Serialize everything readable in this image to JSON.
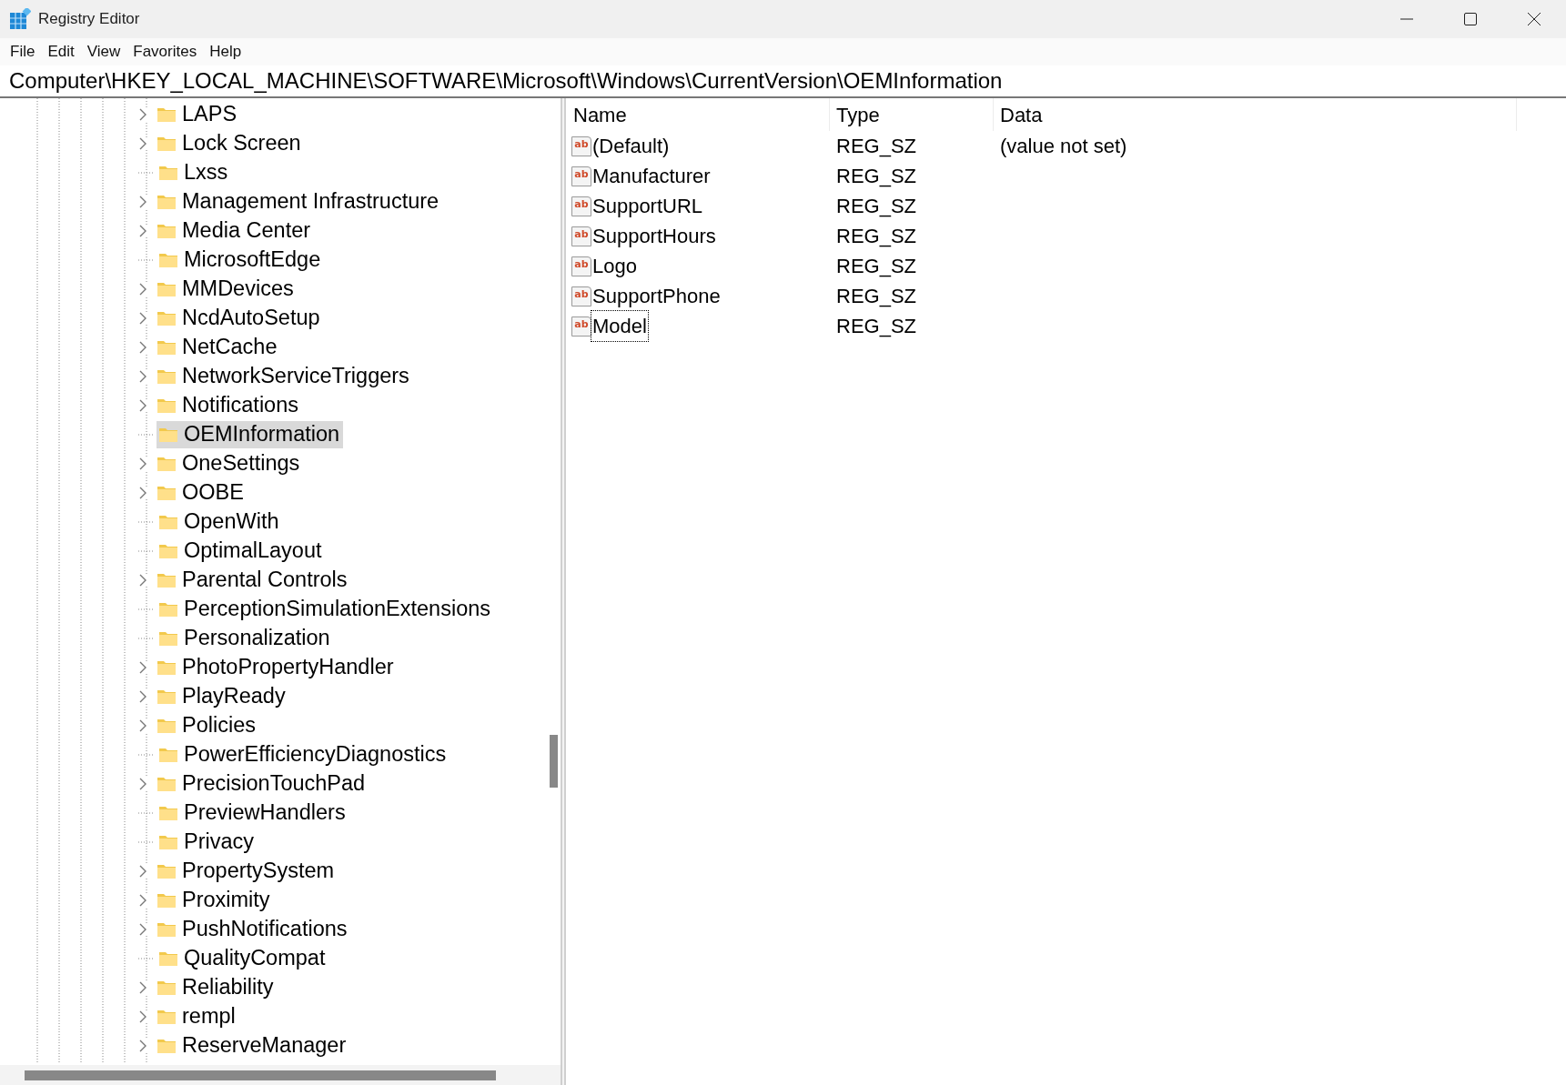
{
  "window": {
    "title": "Registry Editor"
  },
  "menu": [
    "File",
    "Edit",
    "View",
    "Favorites",
    "Help"
  ],
  "address": "Computer\\HKEY_LOCAL_MACHINE\\SOFTWARE\\Microsoft\\Windows\\CurrentVersion\\OEMInformation",
  "tree": {
    "items": [
      {
        "label": "LAPS",
        "has_children": true,
        "selected": false
      },
      {
        "label": "Lock Screen",
        "has_children": true,
        "selected": false
      },
      {
        "label": "Lxss",
        "has_children": false,
        "selected": false
      },
      {
        "label": "Management Infrastructure",
        "has_children": true,
        "selected": false
      },
      {
        "label": "Media Center",
        "has_children": true,
        "selected": false
      },
      {
        "label": "MicrosoftEdge",
        "has_children": false,
        "selected": false
      },
      {
        "label": "MMDevices",
        "has_children": true,
        "selected": false
      },
      {
        "label": "NcdAutoSetup",
        "has_children": true,
        "selected": false
      },
      {
        "label": "NetCache",
        "has_children": true,
        "selected": false
      },
      {
        "label": "NetworkServiceTriggers",
        "has_children": true,
        "selected": false
      },
      {
        "label": "Notifications",
        "has_children": true,
        "selected": false
      },
      {
        "label": "OEMInformation",
        "has_children": false,
        "selected": true
      },
      {
        "label": "OneSettings",
        "has_children": true,
        "selected": false
      },
      {
        "label": "OOBE",
        "has_children": true,
        "selected": false
      },
      {
        "label": "OpenWith",
        "has_children": false,
        "selected": false
      },
      {
        "label": "OptimalLayout",
        "has_children": false,
        "selected": false
      },
      {
        "label": "Parental Controls",
        "has_children": true,
        "selected": false
      },
      {
        "label": "PerceptionSimulationExtensions",
        "has_children": false,
        "selected": false
      },
      {
        "label": "Personalization",
        "has_children": false,
        "selected": false
      },
      {
        "label": "PhotoPropertyHandler",
        "has_children": true,
        "selected": false
      },
      {
        "label": "PlayReady",
        "has_children": true,
        "selected": false
      },
      {
        "label": "Policies",
        "has_children": true,
        "selected": false
      },
      {
        "label": "PowerEfficiencyDiagnostics",
        "has_children": false,
        "selected": false
      },
      {
        "label": "PrecisionTouchPad",
        "has_children": true,
        "selected": false
      },
      {
        "label": "PreviewHandlers",
        "has_children": false,
        "selected": false
      },
      {
        "label": "Privacy",
        "has_children": false,
        "selected": false
      },
      {
        "label": "PropertySystem",
        "has_children": true,
        "selected": false
      },
      {
        "label": "Proximity",
        "has_children": true,
        "selected": false
      },
      {
        "label": "PushNotifications",
        "has_children": true,
        "selected": false
      },
      {
        "label": "QualityCompat",
        "has_children": false,
        "selected": false
      },
      {
        "label": "Reliability",
        "has_children": true,
        "selected": false
      },
      {
        "label": "rempl",
        "has_children": true,
        "selected": false
      },
      {
        "label": "ReserveManager",
        "has_children": true,
        "selected": false
      }
    ]
  },
  "values": {
    "columns": [
      "Name",
      "Type",
      "Data"
    ],
    "rows": [
      {
        "icon": "ab",
        "name": "(Default)",
        "type": "REG_SZ",
        "data": "(value not set)",
        "focused": false
      },
      {
        "icon": "ab",
        "name": "Manufacturer",
        "type": "REG_SZ",
        "focused": false
      },
      {
        "icon": "ab",
        "name": "SupportURL",
        "type": "REG_SZ",
        "focused": false
      },
      {
        "icon": "ab",
        "name": "SupportHours",
        "type": "REG_SZ",
        "focused": false
      },
      {
        "icon": "ab",
        "name": "Logo",
        "type": "REG_SZ",
        "focused": false
      },
      {
        "icon": "ab",
        "name": "SupportPhone",
        "type": "REG_SZ",
        "focused": false
      },
      {
        "icon": "ab",
        "name": "Model",
        "type": "REG_SZ",
        "focused": true
      }
    ]
  }
}
